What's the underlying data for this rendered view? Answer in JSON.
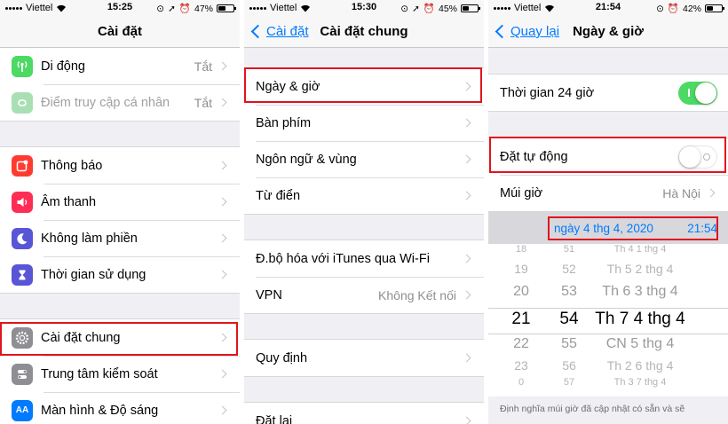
{
  "colors": {
    "accent": "#007aff",
    "toggle_on": "#4cd964",
    "highlight_box": "#e0141e"
  },
  "screen1": {
    "status": {
      "carrier": "Viettel",
      "time": "15:25",
      "battery": "47%",
      "battery_level": 0.47
    },
    "title": "Cài đặt",
    "group1": [
      {
        "label": "Di động",
        "value": "Tắt",
        "icon": "antenna-icon",
        "icon_color": "#4cd964"
      },
      {
        "label": "Điểm truy cập cá nhân",
        "value": "Tắt",
        "icon": "hotspot-icon",
        "icon_color": "#a8e0b4"
      }
    ],
    "group2": [
      {
        "label": "Thông báo",
        "icon": "notifications-icon",
        "icon_color": "#ff3b30"
      },
      {
        "label": "Âm thanh",
        "icon": "speaker-icon",
        "icon_color": "#ff2d55"
      },
      {
        "label": "Không làm phiền",
        "icon": "moon-icon",
        "icon_color": "#5856d6"
      },
      {
        "label": "Thời gian sử dụng",
        "icon": "hourglass-icon",
        "icon_color": "#5856d6"
      }
    ],
    "group3": [
      {
        "label": "Cài đặt chung",
        "icon": "gear-icon",
        "icon_color": "#8e8e93"
      },
      {
        "label": "Trung tâm kiểm soát",
        "icon": "switches-icon",
        "icon_color": "#8e8e93"
      },
      {
        "label": "Màn hình & Độ sáng",
        "icon": "text-size-icon",
        "icon_color": "#007aff"
      }
    ]
  },
  "screen2": {
    "status": {
      "carrier": "Viettel",
      "time": "15:30",
      "battery": "45%",
      "battery_level": 0.45
    },
    "back_label": "Cài đặt",
    "title": "Cài đặt chung",
    "group1": [
      {
        "label": "Ngày & giờ"
      },
      {
        "label": "Bàn phím"
      },
      {
        "label": "Ngôn ngữ & vùng"
      },
      {
        "label": "Từ điển"
      }
    ],
    "group2": [
      {
        "label": "Đ.bộ hóa với iTunes qua Wi-Fi"
      },
      {
        "label": "VPN",
        "value": "Không Kết nối"
      }
    ],
    "group3": [
      {
        "label": "Quy định"
      }
    ],
    "group4": [
      {
        "label": "Đặt lại"
      }
    ]
  },
  "screen3": {
    "status": {
      "carrier": "Viettel",
      "time": "21:54",
      "battery": "42%",
      "battery_level": 0.42
    },
    "back_label": "Quay lại",
    "title": "Ngày & giờ",
    "time24": {
      "label": "Thời gian 24 giờ",
      "on": true
    },
    "auto": {
      "label": "Đặt tự động",
      "on": false
    },
    "timezone": {
      "label": "Múi giờ",
      "value": "Hà Nội"
    },
    "date_display": "ngày 4 thg 4, 2020",
    "time_display": "21:54",
    "picker": {
      "dates": [
        "Th 4 1 thg 4",
        "Th 5 2 thg 4",
        "Th 6 3 thg 4",
        "Th 7 4 thg 4",
        "CN 5 thg 4",
        "Th 2 6 thg 4",
        "Th 3 7 thg 4"
      ],
      "hours": [
        "18",
        "19",
        "20",
        "21",
        "22",
        "23",
        "0"
      ],
      "minutes": [
        "51",
        "52",
        "53",
        "54",
        "55",
        "56",
        "57"
      ],
      "selected_index": 3
    },
    "footer": "Định nghĩa múi giờ đã cập nhật có sẵn và sẽ"
  }
}
